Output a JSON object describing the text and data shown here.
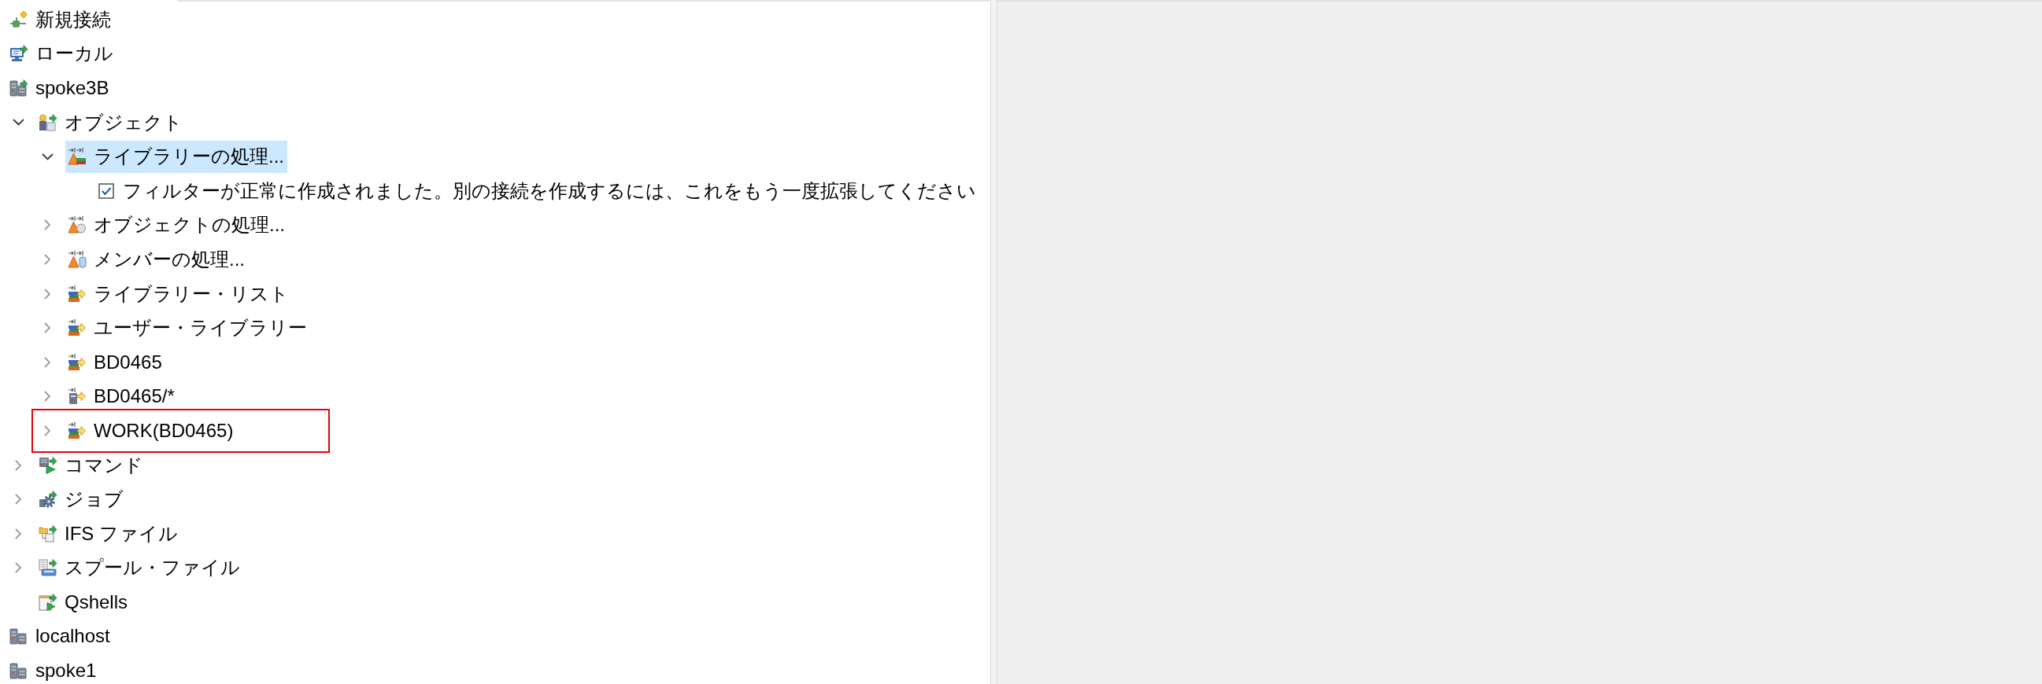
{
  "tree": {
    "items": [
      {
        "label": "新規接続",
        "kind": "wizard",
        "selected": false,
        "outlined": false
      },
      {
        "label": "ローカル",
        "kind": "local",
        "selected": false,
        "outlined": false
      },
      {
        "label": "spoke3B",
        "kind": "activehost",
        "selected": false,
        "outlined": false,
        "children": [
          {
            "label": "オブジェクト",
            "kind": "objects",
            "selected": false,
            "outlined": false,
            "expanded": true,
            "children": [
              {
                "label": "ライブラリーの処理...",
                "kind": "librarypool",
                "selected": true,
                "outlined": false,
                "expanded": true,
                "children": [
                  {
                    "label": "フィルターが正常に作成されました。別の接続を作成するには、これをもう一度拡張してください",
                    "kind": "message",
                    "selected": false,
                    "outlined": false
                  }
                ]
              },
              {
                "label": "オブジェクトの処理...",
                "kind": "objectpool",
                "selected": false,
                "outlined": false,
                "expanded": false
              },
              {
                "label": "メンバーの処理...",
                "kind": "memberpool",
                "selected": false,
                "outlined": false,
                "expanded": false
              },
              {
                "label": "ライブラリー・リスト",
                "kind": "libfilter",
                "selected": false,
                "outlined": false,
                "expanded": false
              },
              {
                "label": "ユーザー・ライブラリー",
                "kind": "libfilter",
                "selected": false,
                "outlined": false,
                "expanded": false
              },
              {
                "label": "BD0465",
                "kind": "libfilter",
                "selected": false,
                "outlined": false,
                "expanded": false
              },
              {
                "label": "BD0465/*",
                "kind": "objfilter",
                "selected": false,
                "outlined": false,
                "expanded": false
              },
              {
                "label": "WORK(BD0465)",
                "kind": "libfilter",
                "selected": false,
                "outlined": true,
                "expanded": false
              }
            ]
          },
          {
            "label": "コマンド",
            "kind": "commands",
            "selected": false,
            "outlined": false,
            "expanded": false
          },
          {
            "label": "ジョブ",
            "kind": "jobs",
            "selected": false,
            "outlined": false,
            "expanded": false
          },
          {
            "label": "IFS ファイル",
            "kind": "ifs",
            "selected": false,
            "outlined": false,
            "expanded": false
          },
          {
            "label": "スプール・ファイル",
            "kind": "spool",
            "selected": false,
            "outlined": false,
            "expanded": false
          },
          {
            "label": "Qshells",
            "kind": "qshell",
            "selected": false,
            "outlined": false
          }
        ]
      },
      {
        "label": "localhost",
        "kind": "host",
        "selected": false,
        "outlined": false
      },
      {
        "label": "spoke1",
        "kind": "host",
        "selected": false,
        "outlined": false
      }
    ]
  }
}
